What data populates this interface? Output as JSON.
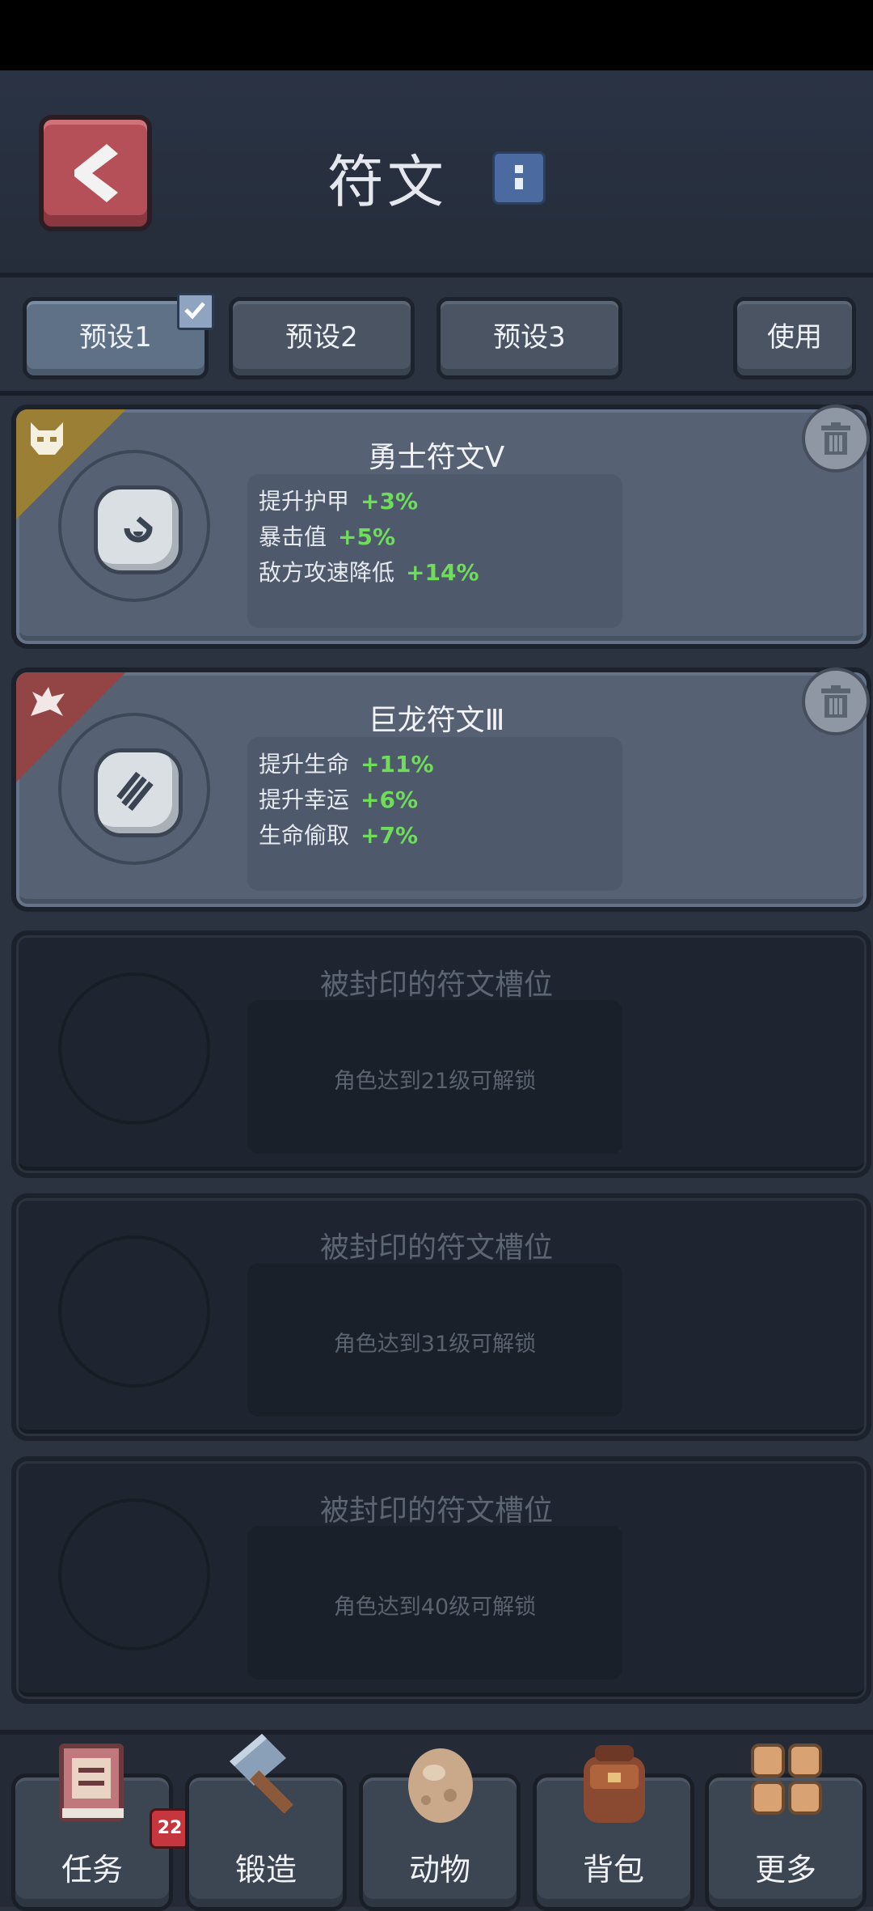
{
  "header": {
    "title": "符文"
  },
  "presets": {
    "items": [
      {
        "label": "预设1",
        "selected": true
      },
      {
        "label": "预设2",
        "selected": false
      },
      {
        "label": "预设3",
        "selected": false
      }
    ],
    "use_label": "使用"
  },
  "runes": [
    {
      "name": "勇士符文Ⅴ",
      "corner_color": "#9a7f34",
      "stats": [
        {
          "label": "提升护甲",
          "value": "+3%"
        },
        {
          "label": "暴击值",
          "value": "+5%"
        },
        {
          "label": "敌方攻速降低",
          "value": "+14%"
        }
      ]
    },
    {
      "name": "巨龙符文Ⅲ",
      "corner_color": "#934545",
      "stats": [
        {
          "label": "提升生命",
          "value": "+11%"
        },
        {
          "label": "提升幸运",
          "value": "+6%"
        },
        {
          "label": "生命偷取",
          "value": "+7%"
        }
      ]
    }
  ],
  "locked_slots": [
    {
      "title": "被封印的符文槽位",
      "requirement": "角色达到21级可解锁"
    },
    {
      "title": "被封印的符文槽位",
      "requirement": "角色达到31级可解锁"
    },
    {
      "title": "被封印的符文槽位",
      "requirement": "角色达到40级可解锁"
    }
  ],
  "nav": {
    "items": [
      {
        "label": "任务",
        "icon": "quest-book-icon",
        "badge": "22"
      },
      {
        "label": "锻造",
        "icon": "hammer-icon"
      },
      {
        "label": "动物",
        "icon": "egg-icon"
      },
      {
        "label": "背包",
        "icon": "backpack-icon"
      },
      {
        "label": "更多",
        "icon": "grid-more-icon"
      }
    ]
  },
  "colors": {
    "stat_value": "#6fdc5a",
    "accent_back": "#b55058"
  }
}
